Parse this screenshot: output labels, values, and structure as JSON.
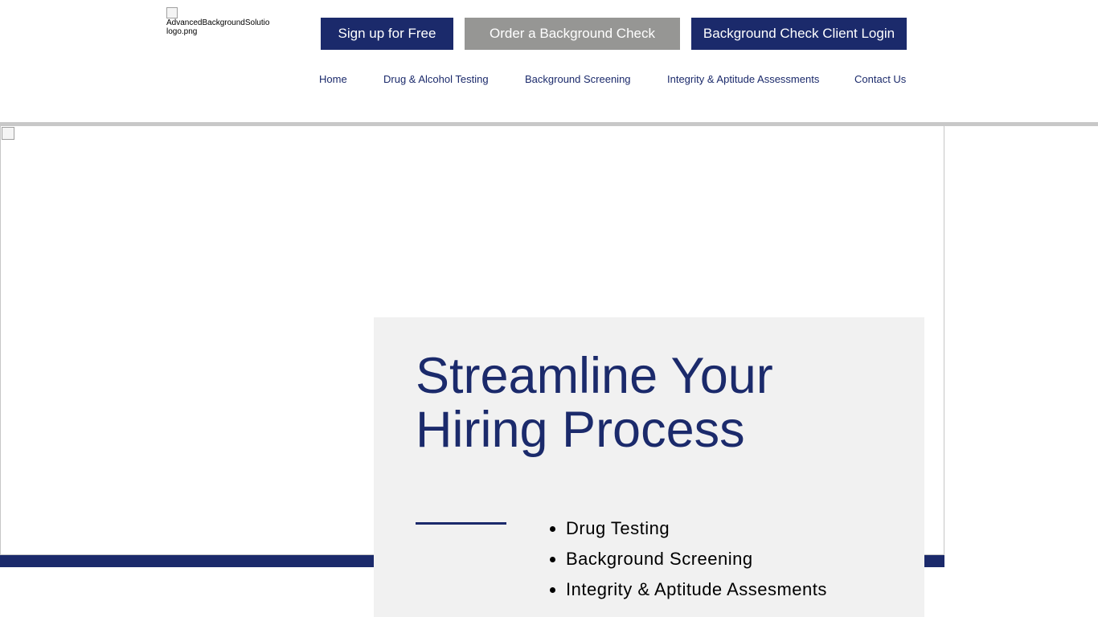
{
  "header": {
    "logo_alt": "AdvancedBackgroundSolutio logo.png",
    "logo_alt_line1": "AdvancedBackgroundSolutio",
    "logo_alt_line2": "logo.png",
    "buttons": {
      "signup": "Sign up for Free",
      "order": "Order a Background Check",
      "login": "Background Check Client Login"
    },
    "nav": [
      {
        "label": "Home"
      },
      {
        "label": "Drug & Alcohol Testing"
      },
      {
        "label": "Background Screening"
      },
      {
        "label": "Integrity & Aptitude Assessments"
      },
      {
        "label": "Contact Us"
      }
    ]
  },
  "hero": {
    "title": "Streamline Your Hiring Process",
    "services": [
      "Drug Testing",
      "Background Screening",
      "Integrity & Aptitude Assesments"
    ]
  },
  "colors": {
    "brand_navy": "#1b2a6b",
    "button_gray": "#969694",
    "card_background": "#f1f1f1",
    "divider_gray": "#c8c8c8"
  },
  "icons": {
    "logo": "broken-image-icon",
    "hero": "broken-image-icon"
  }
}
